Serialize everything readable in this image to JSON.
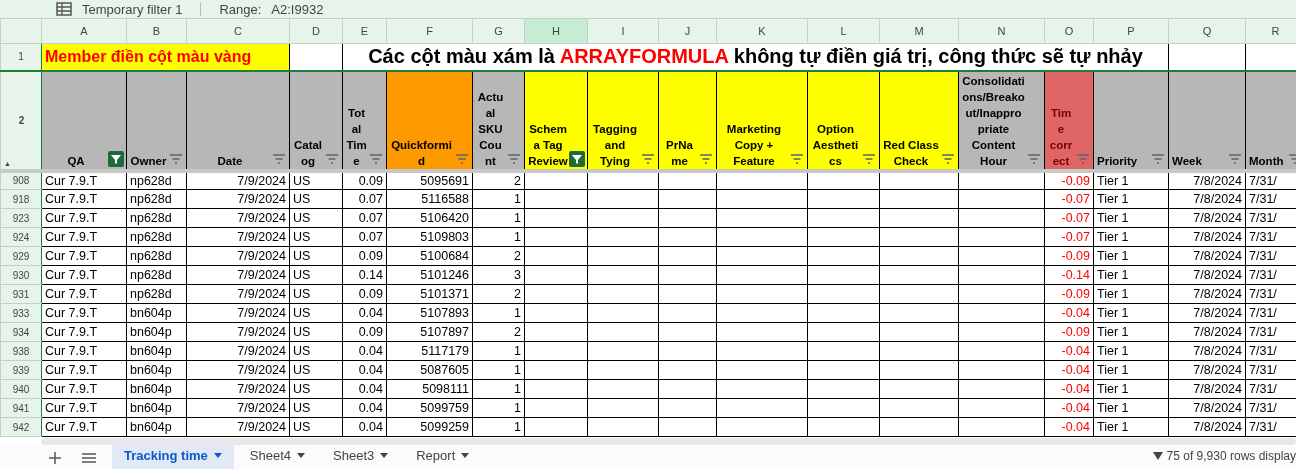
{
  "filter_bar": {
    "filter_name": "Temporary filter 1",
    "range_label": "Range:",
    "range_value": "A2:I9932"
  },
  "columns": [
    {
      "letter": "A",
      "header": "QA",
      "color": "#b7b7b7",
      "kind": "text",
      "filter_active": true,
      "selected": false
    },
    {
      "letter": "B",
      "header": "Owner",
      "color": "#b7b7b7",
      "kind": "text",
      "filter_active": false,
      "selected": false
    },
    {
      "letter": "C",
      "header": "Date",
      "color": "#b7b7b7",
      "kind": "number",
      "filter_active": false,
      "selected": false
    },
    {
      "letter": "D",
      "header": "Catalog",
      "color": "#b7b7b7",
      "kind": "text",
      "filter_active": false,
      "selected": false
    },
    {
      "letter": "E",
      "header": "Total Time",
      "color": "#b7b7b7",
      "kind": "number",
      "filter_active": false,
      "selected": false
    },
    {
      "letter": "F",
      "header": "Quickformid",
      "color": "#ff9900",
      "kind": "number",
      "filter_active": false,
      "selected": false
    },
    {
      "letter": "G",
      "header": "Actual SKU Count",
      "color": "#b7b7b7",
      "kind": "number",
      "filter_active": false,
      "selected": false
    },
    {
      "letter": "H",
      "header": "Schema Tag Review",
      "color": "#ffff00",
      "kind": "text",
      "filter_active": true,
      "selected": true
    },
    {
      "letter": "I",
      "header": "Tagging and Tying",
      "color": "#ffff00",
      "kind": "text",
      "filter_active": false,
      "selected": false
    },
    {
      "letter": "J",
      "header": "PrName",
      "color": "#ffff00",
      "kind": "text",
      "filter_active": false,
      "selected": false
    },
    {
      "letter": "K",
      "header": "Marketing Copy + Feature",
      "color": "#ffff00",
      "kind": "text",
      "filter_active": false,
      "selected": false
    },
    {
      "letter": "L",
      "header": "Option Aesthetics",
      "color": "#ffff00",
      "kind": "text",
      "filter_active": false,
      "selected": false
    },
    {
      "letter": "M",
      "header": "Red Class Check",
      "color": "#ffff00",
      "kind": "text",
      "filter_active": false,
      "selected": false
    },
    {
      "letter": "N",
      "header": "Consolidations/Breakout/Inappropriate Content Hour",
      "color": "#b7b7b7",
      "kind": "text",
      "filter_active": false,
      "selected": false
    },
    {
      "letter": "O",
      "header": "Time correct",
      "color": "#e06666",
      "kind": "alert",
      "filter_active": false,
      "selected": false
    },
    {
      "letter": "P",
      "header": "Priority",
      "color": "#b7b7b7",
      "kind": "text",
      "filter_active": false,
      "selected": false
    },
    {
      "letter": "Q",
      "header": "Week",
      "color": "#b7b7b7",
      "kind": "number",
      "filter_active": false,
      "selected": false
    },
    {
      "letter": "R",
      "header": "Month",
      "color": "#b7b7b7",
      "kind": "text",
      "filter_active": false,
      "selected": false
    }
  ],
  "first_row": {
    "number": "1",
    "note": "Member điền cột màu vàng",
    "title_parts": [
      {
        "text": "Các cột màu xám là ",
        "highlight": false
      },
      {
        "text": "ARRAYFORMULA",
        "highlight": true
      },
      {
        "text": " không tự điền giá trị, công thức sẽ tự nhảy",
        "highlight": false
      }
    ]
  },
  "header_row_number": "2",
  "header_row_marker": "▲",
  "rows": [
    {
      "number": "908",
      "cells": {
        "A": "Cur 7.9.T",
        "B": "np628d",
        "C": "7/9/2024",
        "D": "US",
        "E": "0.09",
        "F": "5095691",
        "G": "2",
        "O": "-0.09",
        "P": "Tier 1",
        "Q": "7/8/2024",
        "R": "7/31/"
      }
    },
    {
      "number": "918",
      "cells": {
        "A": "Cur 7.9.T",
        "B": "np628d",
        "C": "7/9/2024",
        "D": "US",
        "E": "0.07",
        "F": "5116588",
        "G": "1",
        "O": "-0.07",
        "P": "Tier 1",
        "Q": "7/8/2024",
        "R": "7/31/"
      }
    },
    {
      "number": "923",
      "cells": {
        "A": "Cur 7.9.T",
        "B": "np628d",
        "C": "7/9/2024",
        "D": "US",
        "E": "0.07",
        "F": "5106420",
        "G": "1",
        "O": "-0.07",
        "P": "Tier 1",
        "Q": "7/8/2024",
        "R": "7/31/"
      }
    },
    {
      "number": "924",
      "cells": {
        "A": "Cur 7.9.T",
        "B": "np628d",
        "C": "7/9/2024",
        "D": "US",
        "E": "0.07",
        "F": "5109803",
        "G": "1",
        "O": "-0.07",
        "P": "Tier 1",
        "Q": "7/8/2024",
        "R": "7/31/"
      }
    },
    {
      "number": "929",
      "cells": {
        "A": "Cur 7.9.T",
        "B": "np628d",
        "C": "7/9/2024",
        "D": "US",
        "E": "0.09",
        "F": "5100684",
        "G": "2",
        "O": "-0.09",
        "P": "Tier 1",
        "Q": "7/8/2024",
        "R": "7/31/"
      }
    },
    {
      "number": "930",
      "cells": {
        "A": "Cur 7.9.T",
        "B": "np628d",
        "C": "7/9/2024",
        "D": "US",
        "E": "0.14",
        "F": "5101246",
        "G": "3",
        "O": "-0.14",
        "P": "Tier 1",
        "Q": "7/8/2024",
        "R": "7/31/"
      }
    },
    {
      "number": "931",
      "cells": {
        "A": "Cur 7.9.T",
        "B": "np628d",
        "C": "7/9/2024",
        "D": "US",
        "E": "0.09",
        "F": "5101371",
        "G": "2",
        "O": "-0.09",
        "P": "Tier 1",
        "Q": "7/8/2024",
        "R": "7/31/"
      }
    },
    {
      "number": "933",
      "cells": {
        "A": "Cur 7.9.T",
        "B": "bn604p",
        "C": "7/9/2024",
        "D": "US",
        "E": "0.04",
        "F": "5107893",
        "G": "1",
        "O": "-0.04",
        "P": "Tier 1",
        "Q": "7/8/2024",
        "R": "7/31/"
      }
    },
    {
      "number": "934",
      "cells": {
        "A": "Cur 7.9.T",
        "B": "bn604p",
        "C": "7/9/2024",
        "D": "US",
        "E": "0.09",
        "F": "5107897",
        "G": "2",
        "O": "-0.09",
        "P": "Tier 1",
        "Q": "7/8/2024",
        "R": "7/31/"
      }
    },
    {
      "number": "938",
      "cells": {
        "A": "Cur 7.9.T",
        "B": "bn604p",
        "C": "7/9/2024",
        "D": "US",
        "E": "0.04",
        "F": "5117179",
        "G": "1",
        "O": "-0.04",
        "P": "Tier 1",
        "Q": "7/8/2024",
        "R": "7/31/"
      }
    },
    {
      "number": "939",
      "cells": {
        "A": "Cur 7.9.T",
        "B": "bn604p",
        "C": "7/9/2024",
        "D": "US",
        "E": "0.04",
        "F": "5087605",
        "G": "1",
        "O": "-0.04",
        "P": "Tier 1",
        "Q": "7/8/2024",
        "R": "7/31/"
      }
    },
    {
      "number": "940",
      "cells": {
        "A": "Cur 7.9.T",
        "B": "bn604p",
        "C": "7/9/2024",
        "D": "US",
        "E": "0.04",
        "F": "5098111",
        "G": "1",
        "O": "-0.04",
        "P": "Tier 1",
        "Q": "7/8/2024",
        "R": "7/31/"
      }
    },
    {
      "number": "941",
      "cells": {
        "A": "Cur 7.9.T",
        "B": "bn604p",
        "C": "7/9/2024",
        "D": "US",
        "E": "0.04",
        "F": "5099759",
        "G": "1",
        "O": "-0.04",
        "P": "Tier 1",
        "Q": "7/8/2024",
        "R": "7/31/"
      }
    },
    {
      "number": "942",
      "cells": {
        "A": "Cur 7.9.T",
        "B": "bn604p",
        "C": "7/9/2024",
        "D": "US",
        "E": "0.04",
        "F": "5099259",
        "G": "1",
        "O": "-0.04",
        "P": "Tier 1",
        "Q": "7/8/2024",
        "R": "7/31/"
      }
    }
  ],
  "sheet_tabs": [
    {
      "label": "Tracking time",
      "selected": true
    },
    {
      "label": "Sheet4",
      "selected": false
    },
    {
      "label": "Sheet3",
      "selected": false
    },
    {
      "label": "Report",
      "selected": false
    }
  ],
  "status": "75 of 9,930 rows display"
}
